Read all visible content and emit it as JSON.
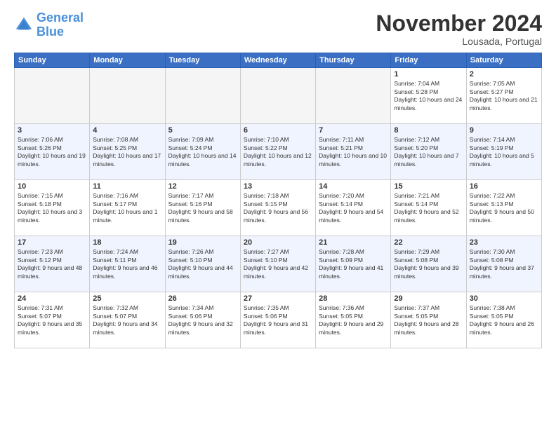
{
  "header": {
    "logo_line1": "General",
    "logo_line2": "Blue",
    "month": "November 2024",
    "location": "Lousada, Portugal"
  },
  "days_of_week": [
    "Sunday",
    "Monday",
    "Tuesday",
    "Wednesday",
    "Thursday",
    "Friday",
    "Saturday"
  ],
  "weeks": [
    [
      {
        "day": "",
        "empty": true
      },
      {
        "day": "",
        "empty": true
      },
      {
        "day": "",
        "empty": true
      },
      {
        "day": "",
        "empty": true
      },
      {
        "day": "",
        "empty": true
      },
      {
        "day": "1",
        "sunrise": "7:04 AM",
        "sunset": "5:28 PM",
        "daylight": "10 hours and 24 minutes."
      },
      {
        "day": "2",
        "sunrise": "7:05 AM",
        "sunset": "5:27 PM",
        "daylight": "10 hours and 21 minutes."
      }
    ],
    [
      {
        "day": "3",
        "sunrise": "7:06 AM",
        "sunset": "5:26 PM",
        "daylight": "10 hours and 19 minutes."
      },
      {
        "day": "4",
        "sunrise": "7:08 AM",
        "sunset": "5:25 PM",
        "daylight": "10 hours and 17 minutes."
      },
      {
        "day": "5",
        "sunrise": "7:09 AM",
        "sunset": "5:24 PM",
        "daylight": "10 hours and 14 minutes."
      },
      {
        "day": "6",
        "sunrise": "7:10 AM",
        "sunset": "5:22 PM",
        "daylight": "10 hours and 12 minutes."
      },
      {
        "day": "7",
        "sunrise": "7:11 AM",
        "sunset": "5:21 PM",
        "daylight": "10 hours and 10 minutes."
      },
      {
        "day": "8",
        "sunrise": "7:12 AM",
        "sunset": "5:20 PM",
        "daylight": "10 hours and 7 minutes."
      },
      {
        "day": "9",
        "sunrise": "7:14 AM",
        "sunset": "5:19 PM",
        "daylight": "10 hours and 5 minutes."
      }
    ],
    [
      {
        "day": "10",
        "sunrise": "7:15 AM",
        "sunset": "5:18 PM",
        "daylight": "10 hours and 3 minutes."
      },
      {
        "day": "11",
        "sunrise": "7:16 AM",
        "sunset": "5:17 PM",
        "daylight": "10 hours and 1 minute."
      },
      {
        "day": "12",
        "sunrise": "7:17 AM",
        "sunset": "5:16 PM",
        "daylight": "9 hours and 58 minutes."
      },
      {
        "day": "13",
        "sunrise": "7:18 AM",
        "sunset": "5:15 PM",
        "daylight": "9 hours and 56 minutes."
      },
      {
        "day": "14",
        "sunrise": "7:20 AM",
        "sunset": "5:14 PM",
        "daylight": "9 hours and 54 minutes."
      },
      {
        "day": "15",
        "sunrise": "7:21 AM",
        "sunset": "5:14 PM",
        "daylight": "9 hours and 52 minutes."
      },
      {
        "day": "16",
        "sunrise": "7:22 AM",
        "sunset": "5:13 PM",
        "daylight": "9 hours and 50 minutes."
      }
    ],
    [
      {
        "day": "17",
        "sunrise": "7:23 AM",
        "sunset": "5:12 PM",
        "daylight": "9 hours and 48 minutes."
      },
      {
        "day": "18",
        "sunrise": "7:24 AM",
        "sunset": "5:11 PM",
        "daylight": "9 hours and 46 minutes."
      },
      {
        "day": "19",
        "sunrise": "7:26 AM",
        "sunset": "5:10 PM",
        "daylight": "9 hours and 44 minutes."
      },
      {
        "day": "20",
        "sunrise": "7:27 AM",
        "sunset": "5:10 PM",
        "daylight": "9 hours and 42 minutes."
      },
      {
        "day": "21",
        "sunrise": "7:28 AM",
        "sunset": "5:09 PM",
        "daylight": "9 hours and 41 minutes."
      },
      {
        "day": "22",
        "sunrise": "7:29 AM",
        "sunset": "5:08 PM",
        "daylight": "9 hours and 39 minutes."
      },
      {
        "day": "23",
        "sunrise": "7:30 AM",
        "sunset": "5:08 PM",
        "daylight": "9 hours and 37 minutes."
      }
    ],
    [
      {
        "day": "24",
        "sunrise": "7:31 AM",
        "sunset": "5:07 PM",
        "daylight": "9 hours and 35 minutes."
      },
      {
        "day": "25",
        "sunrise": "7:32 AM",
        "sunset": "5:07 PM",
        "daylight": "9 hours and 34 minutes."
      },
      {
        "day": "26",
        "sunrise": "7:34 AM",
        "sunset": "5:06 PM",
        "daylight": "9 hours and 32 minutes."
      },
      {
        "day": "27",
        "sunrise": "7:35 AM",
        "sunset": "5:06 PM",
        "daylight": "9 hours and 31 minutes."
      },
      {
        "day": "28",
        "sunrise": "7:36 AM",
        "sunset": "5:05 PM",
        "daylight": "9 hours and 29 minutes."
      },
      {
        "day": "29",
        "sunrise": "7:37 AM",
        "sunset": "5:05 PM",
        "daylight": "9 hours and 28 minutes."
      },
      {
        "day": "30",
        "sunrise": "7:38 AM",
        "sunset": "5:05 PM",
        "daylight": "9 hours and 26 minutes."
      }
    ]
  ]
}
